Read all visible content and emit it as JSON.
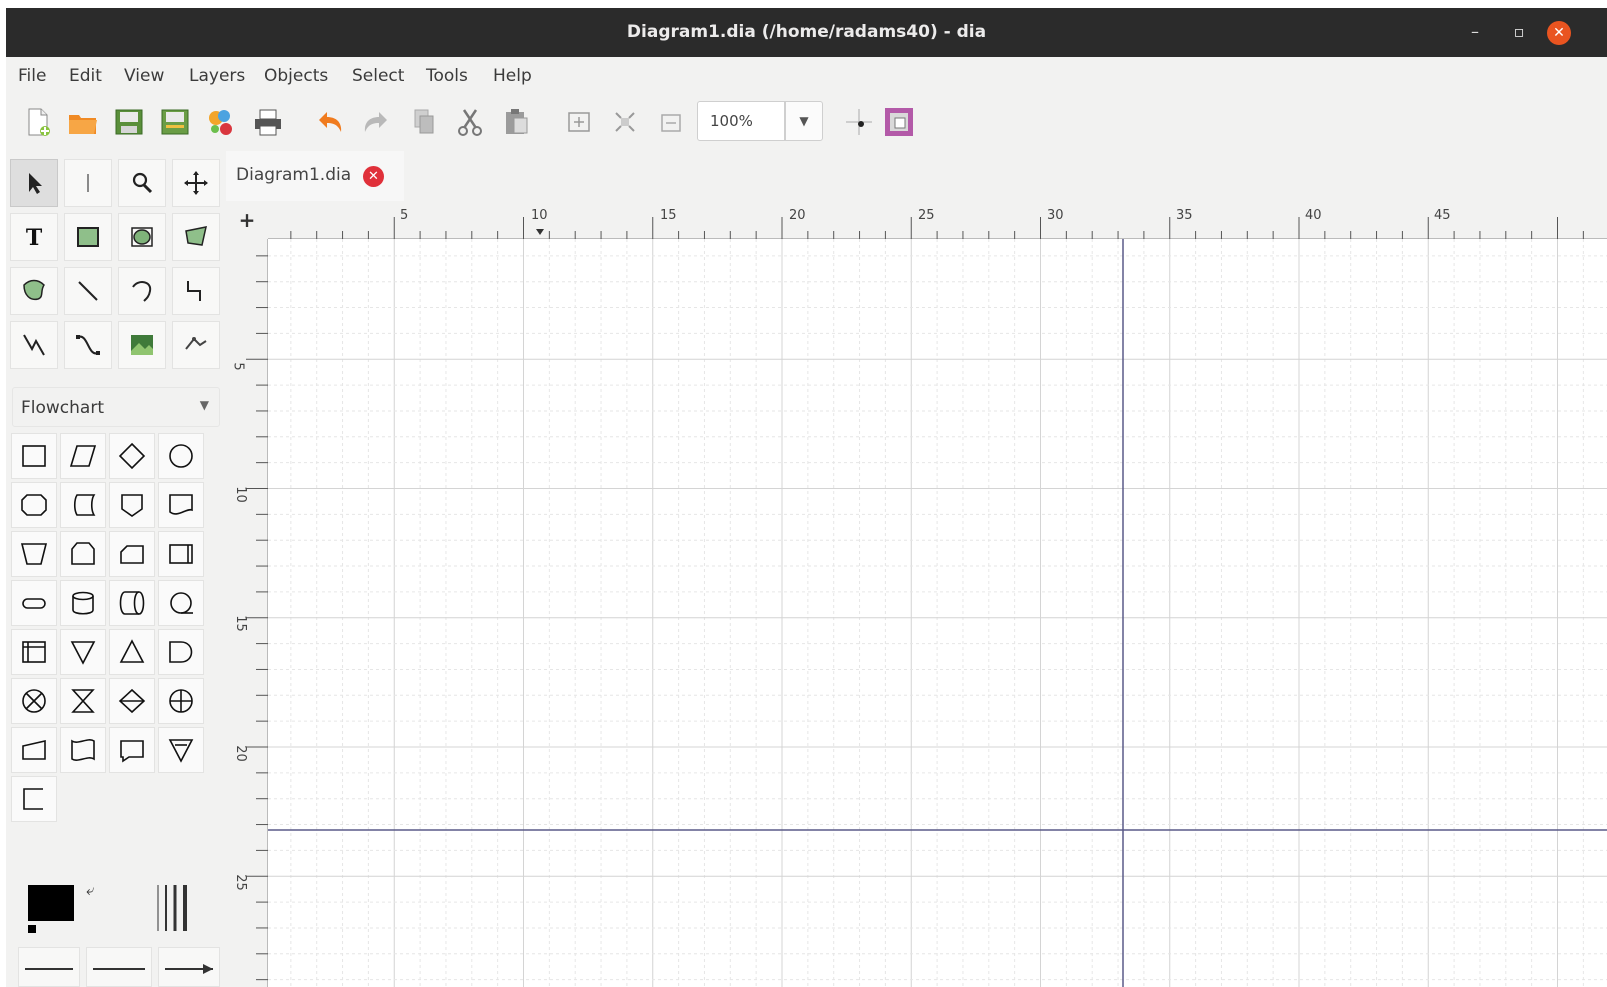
{
  "window": {
    "title": "Diagram1.dia (/home/radams40) - dia",
    "controls": {
      "minimize": "–",
      "maximize": "▫",
      "close": "✕"
    }
  },
  "menubar": {
    "items": [
      "File",
      "Edit",
      "View",
      "Layers",
      "Objects",
      "Select",
      "Tools",
      "Help"
    ]
  },
  "toolbar": {
    "buttons": [
      "new-document-icon",
      "open-folder-icon",
      "save-icon",
      "save-as-icon",
      "export-icon",
      "print-icon",
      "undo-icon",
      "redo-icon",
      "copy-icon",
      "cut-icon",
      "paste-icon",
      "zoom-in-icon",
      "zoom-fit-icon",
      "zoom-out-icon"
    ],
    "zoom_value": "100%",
    "snap_icon": "snap-to-grid-icon",
    "object_snap_icon": "object-snap-icon"
  },
  "tools": [
    "pointer",
    "text-edit",
    "zoom",
    "scroll",
    "text",
    "box",
    "ellipse",
    "polygon",
    "beziergon",
    "line",
    "arc",
    "zigzag-line",
    "polyline",
    "bezier-line",
    "image",
    "outline"
  ],
  "toolbox": {
    "sheet": "Flowchart",
    "shapes_count": 29
  },
  "document": {
    "tab_label": "Diagram1.dia",
    "tab_close": "✕"
  },
  "rulers": {
    "corner": "+",
    "horizontal_labels": [
      "5",
      "10",
      "15",
      "20",
      "25",
      "30",
      "35",
      "40",
      "45"
    ],
    "vertical_labels": [
      "5",
      "10",
      "15",
      "20",
      "25"
    ]
  },
  "colors": {
    "titlebar": "#2b2b2b",
    "close_button": "#e95420",
    "tab_close": "#e0303a",
    "page_border": "#5a5a88",
    "grid_minor": "#e6e6e6",
    "grid_major": "#d4d4d4",
    "foreground": "#000000",
    "background": "#ffffff"
  }
}
